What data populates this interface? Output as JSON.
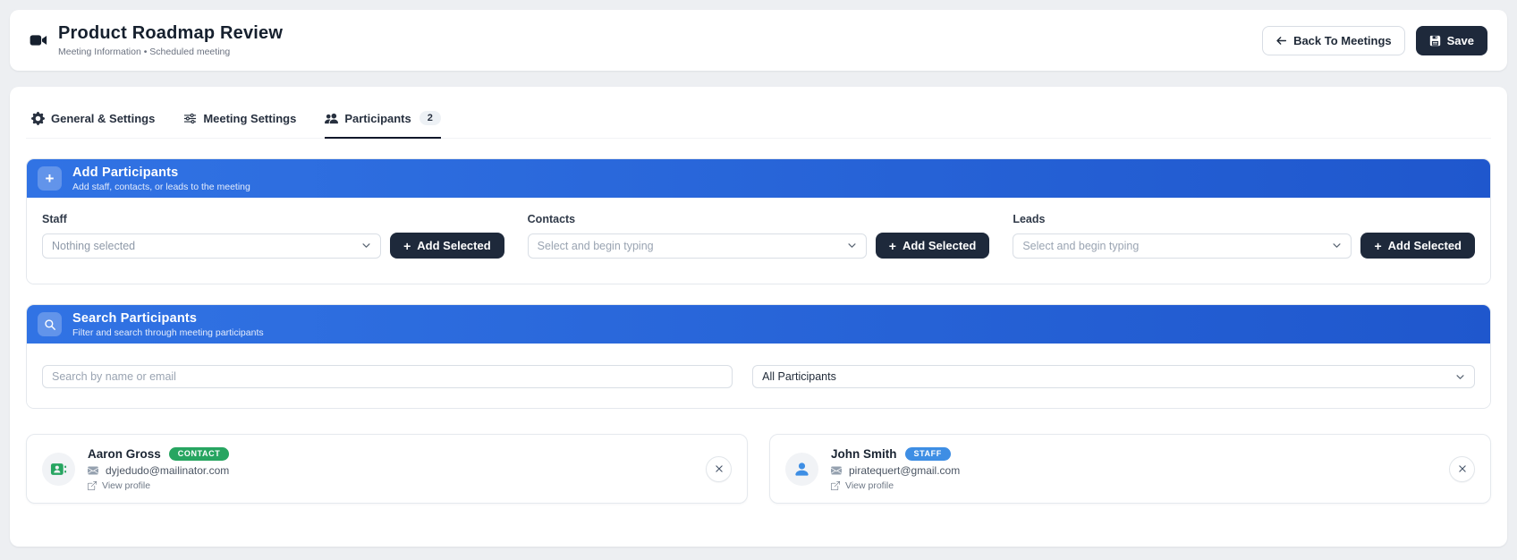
{
  "header": {
    "title": "Product Roadmap Review",
    "subtitle": "Meeting Information • Scheduled meeting",
    "back_label": "Back To Meetings",
    "save_label": "Save",
    "icons": [
      "video-camera-icon",
      "arrow-left-icon",
      "save-icon"
    ]
  },
  "tabs": [
    {
      "label": "General & Settings",
      "icon": "gear-icon",
      "active": false
    },
    {
      "label": "Meeting Settings",
      "icon": "sliders-icon",
      "active": false
    },
    {
      "label": "Participants",
      "icon": "users-icon",
      "active": true,
      "badge": "2"
    }
  ],
  "add_participants": {
    "title": "Add Participants",
    "subtitle": "Add staff, contacts, or leads to the meeting",
    "header_icon": "plus-icon",
    "groups": [
      {
        "label": "Staff",
        "value": "Nothing selected",
        "button": "Add Selected"
      },
      {
        "label": "Contacts",
        "placeholder": "Select and begin typing",
        "button": "Add Selected"
      },
      {
        "label": "Leads",
        "placeholder": "Select and begin typing",
        "button": "Add Selected"
      }
    ]
  },
  "search_participants": {
    "title": "Search Participants",
    "subtitle": "Filter and search through meeting participants",
    "header_icon": "search-icon",
    "search_placeholder": "Search by name or email",
    "filter_value": "All Participants"
  },
  "participants": [
    {
      "name": "Aaron Gross",
      "type": "CONTACT",
      "badge_color": "#27a561",
      "email": "dyjedudo@mailinator.com",
      "view_profile": "View profile",
      "avatar_icon": "contact-card-icon",
      "avatar_color": "#27a561"
    },
    {
      "name": "John Smith",
      "type": "STAFF",
      "badge_color": "#3e8ee4",
      "email": "piratequert@gmail.com",
      "view_profile": "View profile",
      "avatar_icon": "person-icon",
      "avatar_color": "#3e8ee4"
    }
  ],
  "colors": {
    "banner_gradient_start": "#3173e4",
    "banner_gradient_end": "#1f57cd",
    "dark_button": "#1e293b",
    "page_background": "#edeff2"
  }
}
